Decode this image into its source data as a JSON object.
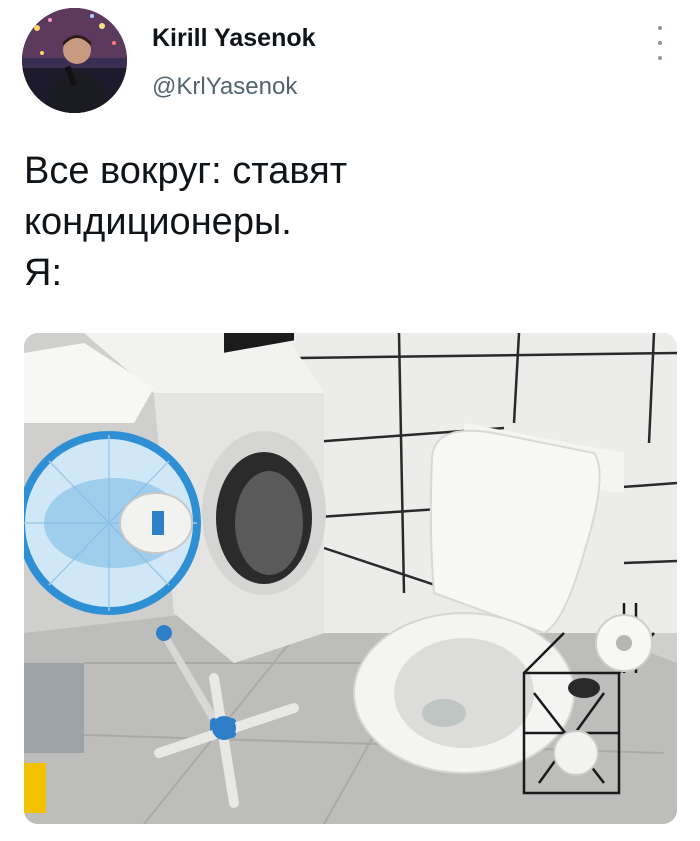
{
  "tweet": {
    "author_name": "Kirill Yasenok",
    "author_handle": "@KrlYasenok",
    "text": "Все вокруг: ставят\nкондиционеры.\nЯ:"
  },
  "icons": {
    "more": "more-vertical-icon"
  },
  "colors": {
    "name": "#0f1419",
    "handle": "#536471",
    "more_icon": "#8a96a3"
  }
}
